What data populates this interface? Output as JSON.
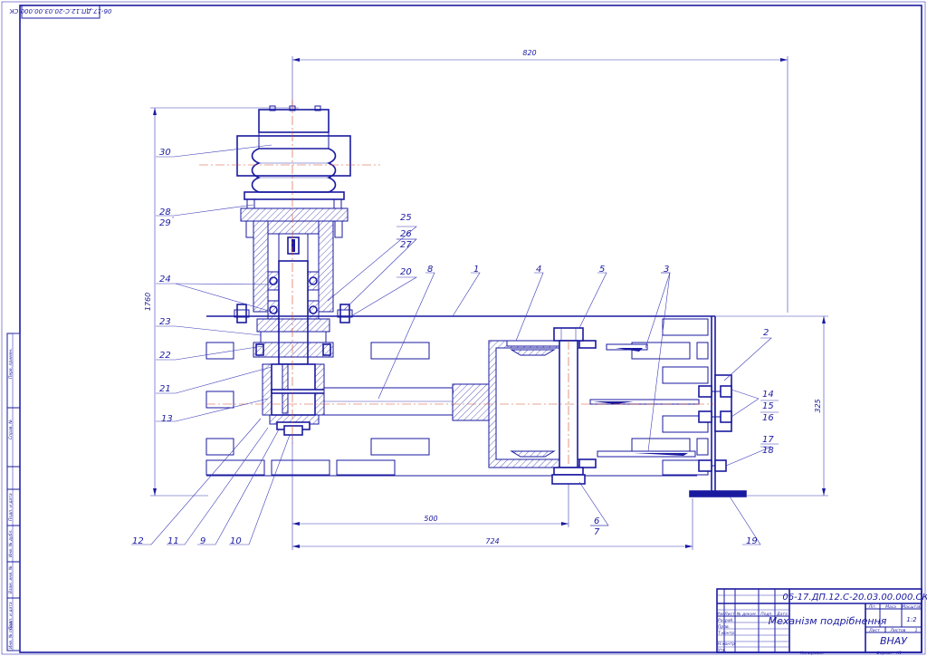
{
  "stamp": {
    "mirror_code": "06-17.ДП.12.С-20.03.00.000.СК"
  },
  "dimensions": {
    "top_width": "820",
    "height_left": "1760",
    "height_right": "325",
    "bottom_500": "500",
    "bottom_724": "724"
  },
  "labels": {
    "l1": "1",
    "l2": "2",
    "l3": "3",
    "l4": "4",
    "l5": "5",
    "l6": "6",
    "l7": "7",
    "l8": "8",
    "l9": "9",
    "l10": "10",
    "l11": "11",
    "l12": "12",
    "l13": "13",
    "l14": "14",
    "l15": "15",
    "l16": "16",
    "l17": "17",
    "l18": "18",
    "l19": "19",
    "l20": "20",
    "l21": "21",
    "l22": "22",
    "l23": "23",
    "l24": "24",
    "l25": "25",
    "l26": "26",
    "l27": "27",
    "l28": "28",
    "l29": "29",
    "l30": "30"
  },
  "side_strip": {
    "s1": "Перв. примен.",
    "s2": "Справ. №",
    "s3": "Подп. и дата",
    "s4": "Инв. № дубл.",
    "s5": "Взам. инв. №",
    "s6": "Подп. и дата",
    "s7": "Инв. № подл."
  },
  "title_block": {
    "doc_number": "06-17.ДП.12.С-20.03.00.000.СК",
    "title": "Механізм подрібнення",
    "org": "ВНАУ",
    "col_lit": "Літ.",
    "col_mass": "Маса",
    "col_scale": "Масштаб",
    "scale_value": "1:2",
    "sheet_label": "Лист",
    "sheets_label": "Листов",
    "sheets_value": "1",
    "h_izm": "Изм",
    "h_list": "Лист",
    "h_doc": "№ докум.",
    "h_sign": "Подп.",
    "h_date": "Дата",
    "r_dev": "Разраб.",
    "r_check": "Пров.",
    "r_tcontrol": "Т.контр.",
    "r_ncontrol": "Н.контр.",
    "r_approve": "Утв.",
    "copied": "Копировал",
    "format_label": "Формат",
    "format_value": "А1"
  }
}
